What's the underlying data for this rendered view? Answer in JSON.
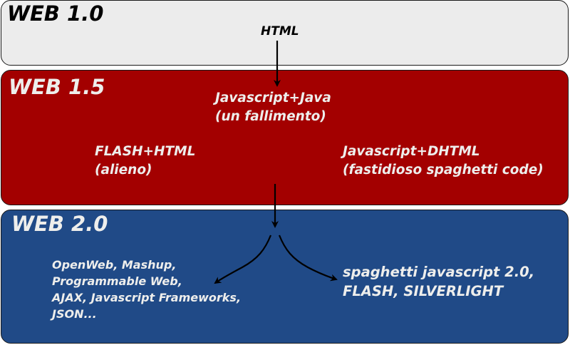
{
  "web10": {
    "title": "WEB 1.0",
    "html_label": "HTML"
  },
  "web15": {
    "title": "WEB 1.5",
    "center_lines": [
      "Javascript+Java",
      "(un fallimento)"
    ],
    "left_lines": [
      "FLASH+HTML",
      "(alieno)"
    ],
    "right_lines": [
      "Javascript+DHTML",
      "(fastidioso spaghetti code)"
    ]
  },
  "web20": {
    "title": "WEB 2.0",
    "left_lines": [
      "OpenWeb, Mashup,",
      "Programmable Web,",
      "AJAX, Javascript Frameworks,",
      "JSON..."
    ],
    "right_lines": [
      "spaghetti javascript 2.0,",
      "FLASH, SILVERLIGHT"
    ]
  },
  "colors": {
    "web10_fill": "#ececec",
    "web15_fill": "#a30000",
    "web20_fill": "#204a87",
    "light_text": "#eeeeec",
    "dark_text": "#000000"
  }
}
